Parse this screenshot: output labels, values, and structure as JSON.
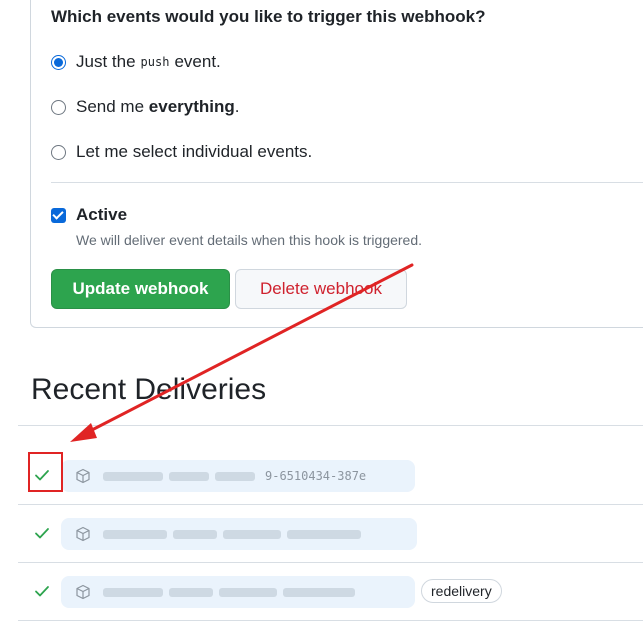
{
  "events": {
    "question": "Which events would you like to trigger this webhook?",
    "options": [
      {
        "prefix": "Just the",
        "code": "push",
        "suffix": "event.",
        "checked": true
      },
      {
        "prefix": "Send me",
        "bold": "everything",
        "suffix": ".",
        "checked": false
      },
      {
        "prefix": "Let me select individual events.",
        "checked": false
      }
    ]
  },
  "active": {
    "label": "Active",
    "description": "We will deliver event details when this hook is triggered.",
    "checked": true
  },
  "buttons": {
    "update": "Update webhook",
    "delete": "Delete webhook"
  },
  "deliveries": {
    "title": "Recent Deliveries",
    "items": [
      {
        "status": "success",
        "guid_visible": "9-6510434-387e",
        "badge": ""
      },
      {
        "status": "success",
        "guid_visible": "",
        "badge": ""
      },
      {
        "status": "success",
        "guid_visible": "",
        "badge": "redelivery"
      }
    ]
  },
  "colors": {
    "success": "#2da44e",
    "danger": "#cf222e",
    "accent": "#0969da",
    "annotation": "#e02424"
  },
  "icons": {
    "status": "check-icon",
    "delivery": "package-icon"
  }
}
